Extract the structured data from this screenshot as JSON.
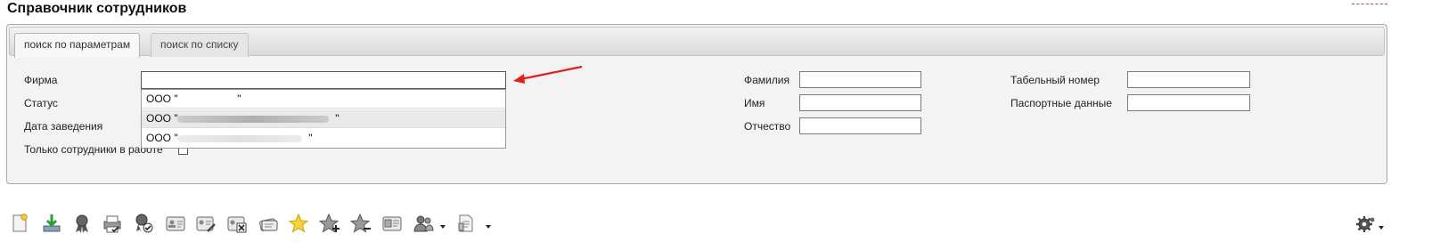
{
  "page": {
    "title": "Справочник сотрудников"
  },
  "tabs": [
    {
      "label": "поиск по параметрам",
      "active": true
    },
    {
      "label": "поиск по списку",
      "active": false
    }
  ],
  "form": {
    "firm_label": "Фирма",
    "firm_value": "",
    "status_label": "Статус",
    "date_label": "Дата заведения",
    "active_only_label": "Только сотрудники в работе",
    "active_only_checked": false,
    "lastname_label": "Фамилия",
    "firstname_label": "Имя",
    "patronymic_label": "Отчество",
    "tabnum_label": "Табельный номер",
    "passport_label": "Паспортные данные"
  },
  "firm_options": [
    {
      "label": "ООО \"",
      "tail": "\""
    },
    {
      "label": "ООО \"",
      "tail": "\""
    },
    {
      "label": "ООО \"",
      "tail": "\""
    }
  ],
  "toolbar": {
    "icons": [
      "new-document-icon",
      "download-icon",
      "award-icon",
      "print-icon",
      "award-check-icon",
      "id-card-icon",
      "id-card-edit-icon",
      "id-card-delete-icon",
      "card-stack-icon",
      "star-icon",
      "star-add-icon",
      "star-remove-icon",
      "id-card-photo-icon",
      "users-icon",
      "document-list-icon"
    ],
    "settings_icon": "gear-icon"
  },
  "colors": {
    "annotation_arrow": "#e02020",
    "panel_bg": "#f3f3f3"
  }
}
